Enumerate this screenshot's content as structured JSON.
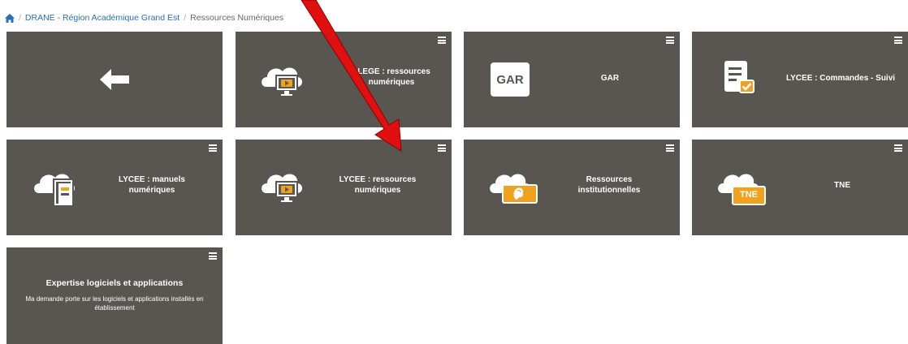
{
  "breadcrumb": {
    "home_icon": "home-icon",
    "items": [
      "DRANE - Région Académique Grand Est",
      "Ressources Numériques"
    ]
  },
  "tiles": {
    "back": {
      "icon": "arrow-left-icon"
    },
    "college_resources": {
      "label": "LLEGE : ressources numériques",
      "icon": "cloud-video-icon"
    },
    "gar": {
      "label": "GAR",
      "icon_text": "GAR"
    },
    "lycee_orders": {
      "label": "LYCEE : Commandes - Suivi",
      "icon": "checklist-icon"
    },
    "lycee_manuals": {
      "label": "LYCEE : manuels numériques",
      "icon": "cloud-book-icon"
    },
    "lycee_resources": {
      "label": "LYCEE : ressources numériques",
      "icon": "cloud-video-icon"
    },
    "institutional": {
      "label": "Ressources institutionnelles",
      "icon": "cloud-marianne-icon"
    },
    "tne": {
      "label": "TNE",
      "icon_text": "TNE"
    },
    "expertise": {
      "title": "Expertise logiciels et applications",
      "description": "Ma demande porte sur les logiciels et applications installés en établissement"
    }
  },
  "colors": {
    "tile_bg": "#595551",
    "accent": "#f0a11e",
    "annotation_arrow": "#e01010",
    "link": "#2a6ebb"
  }
}
